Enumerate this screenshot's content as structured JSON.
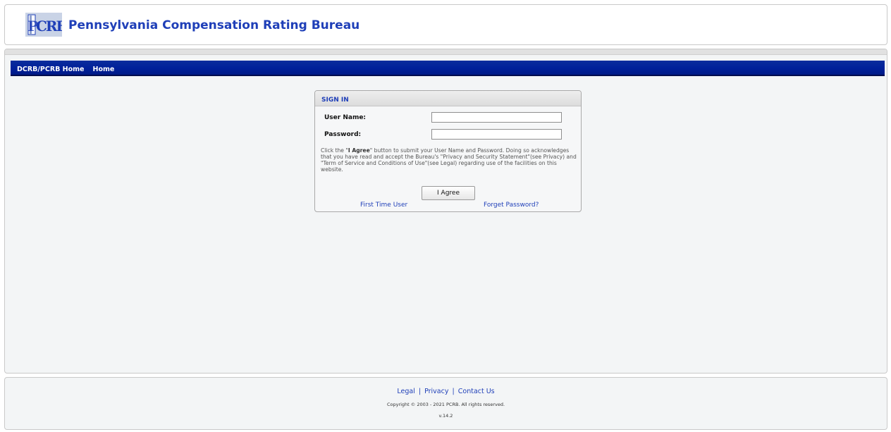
{
  "header": {
    "logo_text": "PCRB",
    "title": "Pennsylvania Compensation Rating Bureau"
  },
  "nav": {
    "items": [
      {
        "label": "DCRB/PCRB Home"
      },
      {
        "label": "Home"
      }
    ]
  },
  "signin": {
    "title": "SIGN IN",
    "username_label": "User Name:",
    "username_value": "",
    "password_label": "Password:",
    "password_value": "",
    "notice_pre": "Click the \"",
    "notice_bold": "I Agree",
    "notice_post": "\" button to submit your User Name and Password. Doing so acknowledges that you have read and accept the Bureau's \"Privacy and Security Statement\"(see Privacy) and \"Term of Service and Conditions of Use\"(see Legal) regarding use of the facilities on this website.",
    "agree_label": "I Agree",
    "first_time_label": "First Time User",
    "forgot_label": "Forget Password?"
  },
  "footer": {
    "legal": "Legal",
    "privacy": "Privacy",
    "contact": "Contact Us",
    "separator": "|",
    "copyright": "Copyright © 2003 - 2021 PCRB. All rights reserved.",
    "version": "v.14.2"
  },
  "colors": {
    "brand_blue": "#1f3fb8",
    "nav_blue": "#00209a"
  }
}
